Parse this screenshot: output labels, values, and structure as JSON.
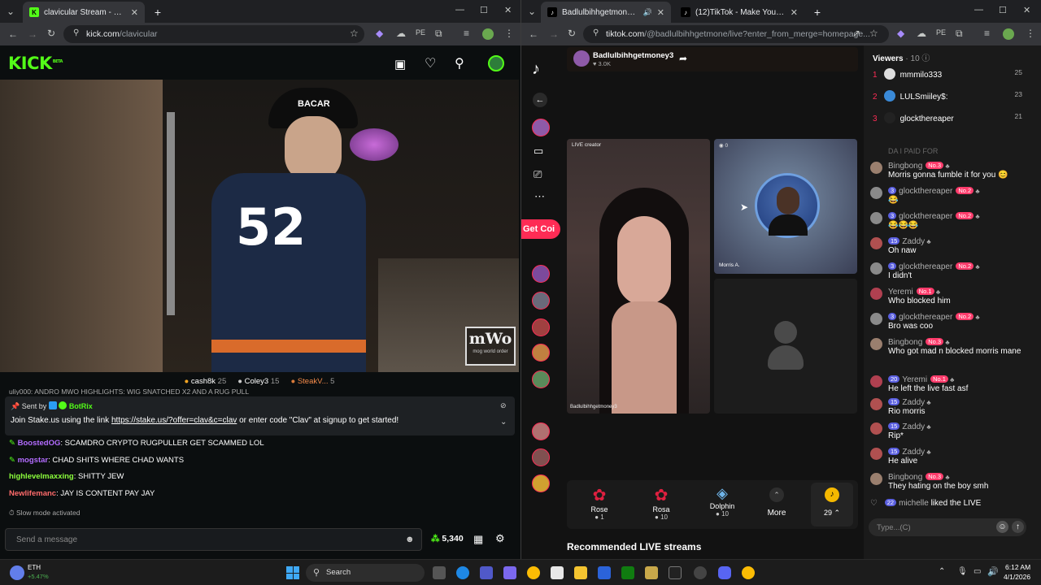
{
  "left_browser": {
    "tab_title": "clavicular Stream - Watch Live o",
    "url_domain": "kick.com",
    "url_path": "/clavicular"
  },
  "kick": {
    "logo": "KICK",
    "logo_beta": "BETA",
    "cap_text": "BACAR",
    "jersey_number": "52",
    "watermark_main": "mWo",
    "watermark_sub": "mog world order",
    "leaderboard": [
      {
        "name": "cash8k",
        "count": "25"
      },
      {
        "name": "Coley3",
        "count": "15"
      },
      {
        "name": "SteakV...",
        "count": "5"
      }
    ],
    "cut_chat_line": "uliy000: ANDRO MWO HIGHLIGHTS: WIG SNATCHED X2 AND A RUG PULL",
    "pinned": {
      "sent_by_label": "Sent by",
      "sender": "BotRix",
      "text_before": "Join Stake.us using the link ",
      "link": "https://stake.us/?offer=clav&c=clav",
      "text_after": " or enter code \"Clav\" at signup to get started!"
    },
    "chat": [
      {
        "user": "BoostedOG",
        "msg": ": SCAMDRO CRYPTO RUGPULLER GET SCAMMED LOL",
        "color": "#b36cff"
      },
      {
        "user": "mogstar",
        "msg": ": CHAD SHITS WHERE CHAD WANTS",
        "color": "#b36cff"
      },
      {
        "user": "highlevelmaxxing",
        "msg": ": SHITTY JEW",
        "color": "#8cff3c"
      },
      {
        "user": "Newlifemanc",
        "msg": ": JAY IS CONTENT PAY JAY",
        "color": "#ff6b6b"
      }
    ],
    "slow_mode": "Slow mode activated",
    "send_placeholder": "Send a message",
    "points": "5,340"
  },
  "right_browser": {
    "tab1_title": "Badlulbihhgetmoney3 (@b",
    "tab2_title": "(12)TikTok - Make Your Day",
    "url_domain": "tiktok.com",
    "url_path": "/@badlulbihhgetmone/live?enter_from_merge=homepage..."
  },
  "tiktok": {
    "host_name": "Badlulbihhgetmoney3",
    "host_likes": "3.0K",
    "get_coins": "Get Coi",
    "live_creator_label": "LIVE creator",
    "guest_count": "0",
    "guest_name": "Morris A.",
    "host_tile_name": "Badlulbihhgetmoney3",
    "gifts": [
      {
        "name": "Rose",
        "cost": "1"
      },
      {
        "name": "Rosa",
        "cost": "10"
      },
      {
        "name": "Dolphin",
        "cost": "10"
      }
    ],
    "more": "More",
    "coins": "29",
    "recommended": "Recommended LIVE streams",
    "viewers_label": "Viewers",
    "viewers_count": "10",
    "top_viewers": [
      {
        "rank": "1",
        "name": "mmmilo333",
        "score": "25"
      },
      {
        "rank": "2",
        "name": "LULSmiiley$:",
        "score": "23"
      },
      {
        "rank": "3",
        "name": "glockthereaper",
        "score": "21"
      }
    ],
    "faded_line": "DA I PAID FOR",
    "comments": [
      {
        "name": "Bingbong",
        "lvl": "",
        "rank": "No.3",
        "msg": "Morris gonna fumble it for you 😊"
      },
      {
        "name": "glockthereaper",
        "lvl": "3",
        "rank": "No.2",
        "msg": "😂"
      },
      {
        "name": "glockthereaper",
        "lvl": "3",
        "rank": "No.2",
        "msg": "😂😂😂"
      },
      {
        "name": "Zaddy",
        "lvl": "15",
        "rank": "",
        "msg": "Oh naw"
      },
      {
        "name": "glockthereaper",
        "lvl": "3",
        "rank": "No.2",
        "msg": "I didn't"
      },
      {
        "name": "Yeremi",
        "lvl": "",
        "rank": "No.1",
        "msg": "Who blocked him"
      },
      {
        "name": "glockthereaper",
        "lvl": "3",
        "rank": "No.2",
        "msg": "Bro was coo"
      },
      {
        "name": "Bingbong",
        "lvl": "",
        "rank": "No.3",
        "msg": "Who got mad n blocked morris mane"
      },
      {
        "name": "Yeremi",
        "lvl": "20",
        "rank": "No.1",
        "msg": "He left the live fast asf"
      },
      {
        "name": "Zaddy",
        "lvl": "15",
        "rank": "",
        "msg": "Rio morris"
      },
      {
        "name": "Zaddy",
        "lvl": "15",
        "rank": "",
        "msg": "Rip*"
      },
      {
        "name": "Zaddy",
        "lvl": "15",
        "rank": "",
        "msg": "He alive"
      },
      {
        "name": "Bingbong",
        "lvl": "",
        "rank": "No.3",
        "msg": "They hating on the boy smh"
      }
    ],
    "like_event": {
      "lvl": "22",
      "name": "michelle",
      "text": "liked the LIVE"
    },
    "type_placeholder": "Type...(C)"
  },
  "taskbar": {
    "crypto_name": "ETH",
    "crypto_change": "+5.47%",
    "search_label": "Search",
    "time": "6:12 AM",
    "date": "4/1/2026"
  }
}
